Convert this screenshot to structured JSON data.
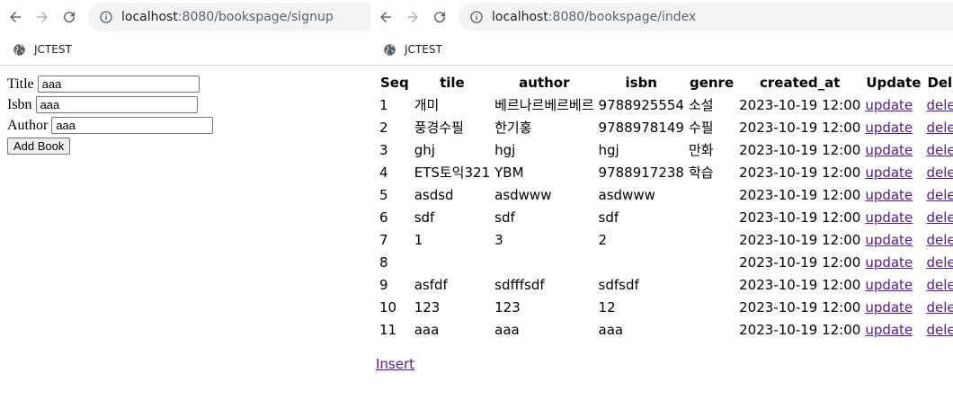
{
  "left_window": {
    "url_host": "localhost",
    "url_rest": ":8080/bookspage/signup",
    "bookmark": "JCTEST",
    "form": {
      "title_label": "Title",
      "title_value": "aaa",
      "isbn_label": "Isbn",
      "isbn_value": "aaa",
      "author_label": "Author",
      "author_value": "aaa",
      "submit_label": "Add Book"
    }
  },
  "right_window": {
    "url_host": "localhost",
    "url_rest": ":8080/bookspage/index",
    "bookmark": "JCTEST",
    "headers": [
      "Seq",
      "tile",
      "author",
      "isbn",
      "genre",
      "created_at",
      "Update",
      "Delete"
    ],
    "rows": [
      {
        "seq": "1",
        "title": "개미",
        "author": "베르나르베르베르",
        "isbn": "9788925554",
        "genre": "소설",
        "created": "2023-10-19 12:00",
        "update": "update",
        "delete": "delete"
      },
      {
        "seq": "2",
        "title": "풍경수필",
        "author": "한기홍",
        "isbn": "9788978149",
        "genre": "수필",
        "created": "2023-10-19 12:00",
        "update": "update",
        "delete": "delete"
      },
      {
        "seq": "3",
        "title": "ghj",
        "author": "hgj",
        "isbn": "hgj",
        "genre": "만화",
        "created": "2023-10-19 12:00",
        "update": "update",
        "delete": "delete"
      },
      {
        "seq": "4",
        "title": "ETS토익321",
        "author": "YBM",
        "isbn": "9788917238",
        "genre": "학습",
        "created": "2023-10-19 12:00",
        "update": "update",
        "delete": "delete"
      },
      {
        "seq": "5",
        "title": "asdsd",
        "author": "asdwww",
        "isbn": "asdwww",
        "genre": "",
        "created": "2023-10-19 12:00",
        "update": "update",
        "delete": "delete"
      },
      {
        "seq": "6",
        "title": "sdf",
        "author": "sdf",
        "isbn": "sdf",
        "genre": "",
        "created": "2023-10-19 12:00",
        "update": "update",
        "delete": "delete"
      },
      {
        "seq": "7",
        "title": "1",
        "author": "3",
        "isbn": "2",
        "genre": "",
        "created": "2023-10-19 12:00",
        "update": "update",
        "delete": "delete"
      },
      {
        "seq": "8",
        "title": "",
        "author": "",
        "isbn": "",
        "genre": "",
        "created": "2023-10-19 12:00",
        "update": "update",
        "delete": "delete"
      },
      {
        "seq": "9",
        "title": "asfdf",
        "author": "sdfffsdf",
        "isbn": "sdfsdf",
        "genre": "",
        "created": "2023-10-19 12:00",
        "update": "update",
        "delete": "delete"
      },
      {
        "seq": "10",
        "title": "123",
        "author": "123",
        "isbn": "12",
        "genre": "",
        "created": "2023-10-19 12:00",
        "update": "update",
        "delete": "delete"
      },
      {
        "seq": "11",
        "title": "aaa",
        "author": "aaa",
        "isbn": "aaa",
        "genre": "",
        "created": "2023-10-19 12:00",
        "update": "update",
        "delete": "delete"
      }
    ],
    "insert_link": "Insert"
  },
  "icons": {
    "back": "arrow-left-icon",
    "forward": "arrow-right-icon",
    "reload": "reload-icon",
    "site_info": "info-circle-icon",
    "bookmark": "globe-icon"
  },
  "colors": {
    "visited_link": "#551a8b",
    "url_bar_bg": "#f1f3f4",
    "disabled_icon": "#b0b3b7"
  }
}
